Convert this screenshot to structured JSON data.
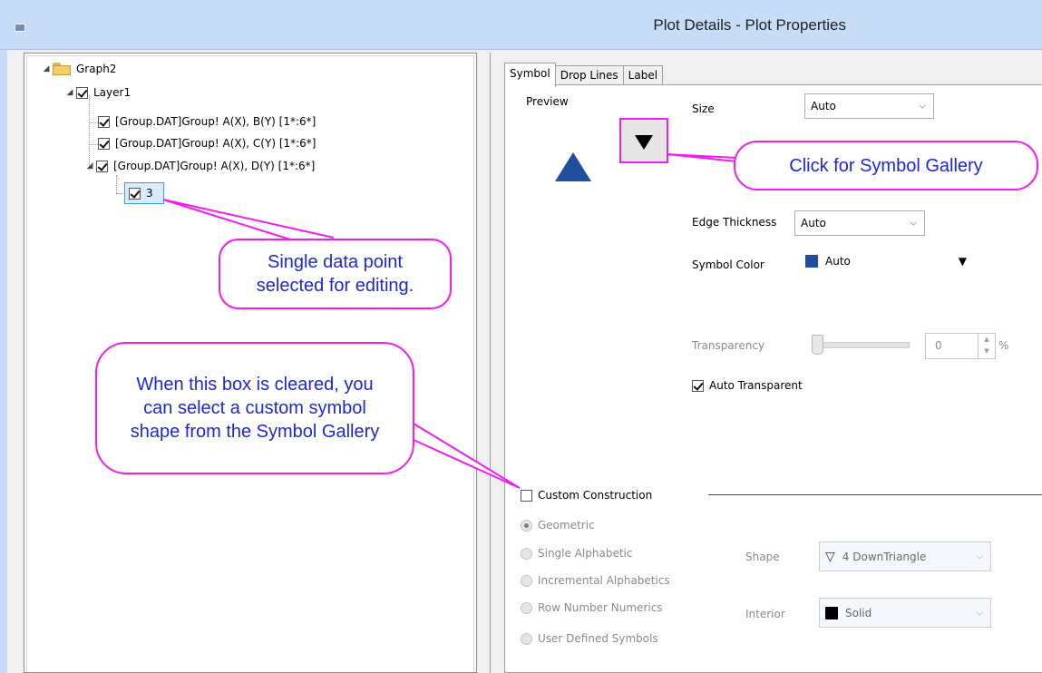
{
  "window": {
    "title": "Plot Details - Plot Properties"
  },
  "tree": {
    "root": "Graph2",
    "layer": "Layer1",
    "plots": [
      "[Group.DAT]Group! A(X), B(Y) [1*:6*]",
      "[Group.DAT]Group! A(X), C(Y) [1*:6*]",
      "[Group.DAT]Group! A(X), D(Y) [1*:6*]"
    ],
    "point": "3"
  },
  "tabs": [
    "Symbol",
    "Drop Lines",
    "Label"
  ],
  "symbol": {
    "preview_label": "Preview",
    "size_label": "Size",
    "size_value": "Auto",
    "edge_thickness_label": "Edge Thickness",
    "edge_thickness_value": "Auto",
    "symbol_color_label": "Symbol Color",
    "symbol_color_value": "Auto",
    "symbol_color_hex": "#1f4e9c",
    "transparency_label": "Transparency",
    "transparency_value": "0",
    "percent_label": "%",
    "auto_transparent_label": "Auto Transparent",
    "custom_construction_label": "Custom Construction",
    "radio_options": [
      "Geometric",
      "Single Alphabetic",
      "Incremental Alphabetics",
      "Row Number Numerics",
      "User Defined Symbols"
    ],
    "shape_label": "Shape",
    "shape_value": "4 DownTriangle",
    "interior_label": "Interior",
    "interior_value": "Solid"
  },
  "callouts": {
    "gallery": "Click for Symbol Gallery",
    "single_point": "Single data point selected for editing.",
    "custom_box": "When this box is cleared, you can select a custom symbol shape from the Symbol Gallery"
  },
  "colors": {
    "callout_border": "#f21bf2",
    "callout_text": "#1d27d6",
    "preview_triangle": "#1f4e9c"
  }
}
